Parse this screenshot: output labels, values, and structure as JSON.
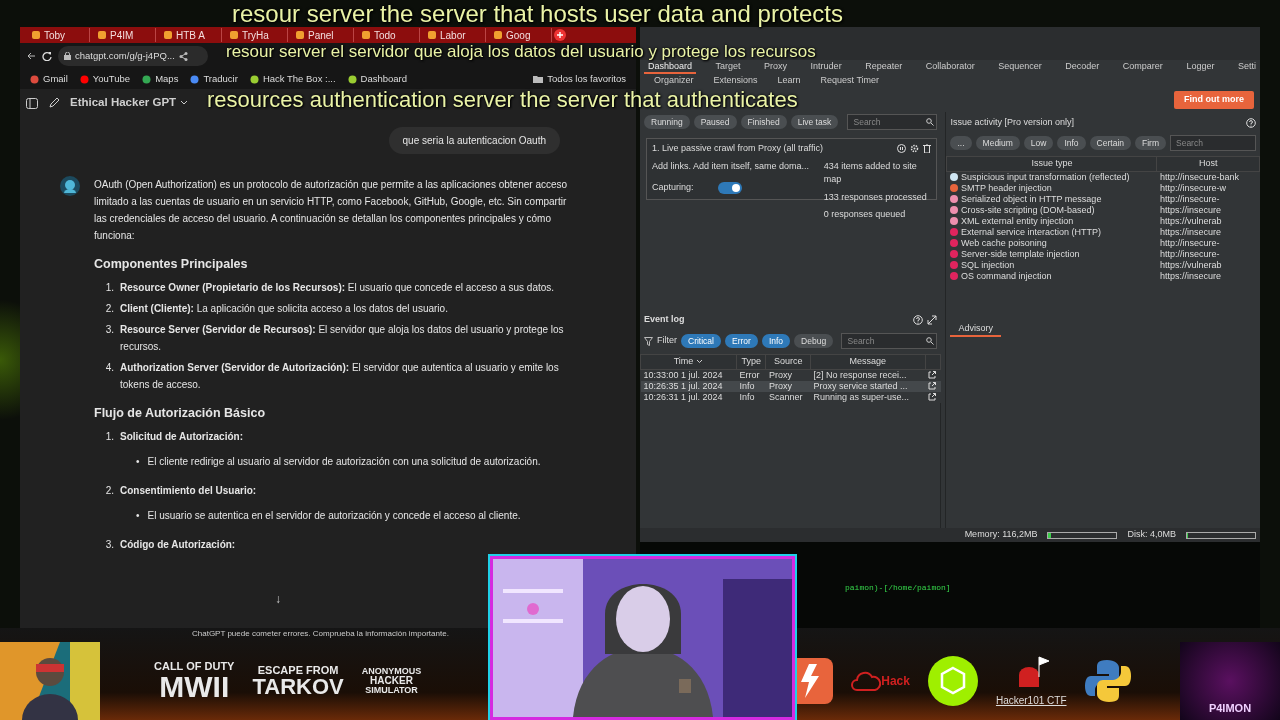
{
  "subtitles": [
    "resour server the server that hosts user data and protects",
    "resour server el servidor que aloja los datos del usuario y protege los recursos",
    "resources authentication server the server that authenticates"
  ],
  "browser": {
    "tabs": [
      {
        "label": "Toby",
        "selected": false
      },
      {
        "label": "P4IM",
        "selected": false
      },
      {
        "label": "HTB A",
        "selected": false
      },
      {
        "label": "TryHa",
        "selected": false
      },
      {
        "label": "Panel",
        "selected": false
      },
      {
        "label": "Todo",
        "selected": false
      },
      {
        "label": "Labor",
        "selected": false
      },
      {
        "label": "Goog",
        "selected": false
      }
    ],
    "url": "chatgpt.com/g/g-j4PQ...",
    "bookmarks": [
      "Gmail",
      "YouTube",
      "Maps",
      "Traducir",
      "Hack The Box :...",
      "Dashboard"
    ],
    "all_bookmarks": "Todos los favoritos"
  },
  "chat": {
    "title": "Ethical Hacker GPT",
    "user_message": "que seria la autenticacion Oauth",
    "intro": "OAuth (Open Authorization) es un protocolo de autorización que permite a las aplicaciones obtener acceso limitado a las cuentas de usuario en un servicio HTTP, como Facebook, GitHub, Google, etc. Sin compartir las credenciales de acceso del usuario. A continuación se detallan los componentes principales y cómo funciona:",
    "sections": [
      {
        "heading": "Componentes Principales",
        "items": [
          {
            "kind": "definition",
            "number": "1.",
            "text": "**Resource Owner (Propietario de los Recursos):** El usuario que concede el acceso a sus datos."
          },
          {
            "kind": "definition",
            "number": "2.",
            "text": "**Client (Cliente):** La aplicación que solicita acceso a los datos del usuario."
          },
          {
            "kind": "definition",
            "number": "3.",
            "text": "**Resource Server (Servidor de Recursos):** El servidor que aloja los datos del usuario y protege los recursos."
          },
          {
            "kind": "definition",
            "number": "4.",
            "text": "**Authorization Server (Servidor de Autorización):** El servidor que autentica al usuario y emite los tokens de acceso."
          }
        ]
      },
      {
        "heading": "Flujo de Autorización Básico",
        "items": [
          {
            "kind": "step",
            "number": "1.",
            "text": "Solicitud de Autorización:",
            "children": [
              {
                "marker": "•",
                "text": "El cliente redirige al usuario al servidor de autorización con una solicitud de autorización."
              }
            ]
          },
          {
            "kind": "step",
            "number": "2.",
            "text": "Consentimiento del Usuario:",
            "children": [
              {
                "marker": "•",
                "text": "El usuario se autentica en el servidor de autorización y concede el acceso al cliente."
              }
            ]
          },
          {
            "kind": "step",
            "number": "3.",
            "text": "Código de Autorización:"
          }
        ]
      }
    ],
    "scroll_arrow": "↓",
    "disclaimer": "ChatGPT puede cometer errores. Comprueba la información importante."
  },
  "burp": {
    "tabs": [
      {
        "label": "Dashboard",
        "selected": true
      },
      {
        "label": "Target",
        "selected": false
      },
      {
        "label": "Proxy",
        "selected": false
      },
      {
        "label": "Intruder",
        "selected": false
      },
      {
        "label": "Repeater",
        "selected": false
      },
      {
        "label": "Collaborator",
        "selected": false
      },
      {
        "label": "Sequencer",
        "selected": false
      },
      {
        "label": "Decoder",
        "selected": false
      },
      {
        "label": "Comparer",
        "selected": false
      },
      {
        "label": "Logger",
        "selected": false
      },
      {
        "label": "Setti",
        "selected": false
      }
    ],
    "subtabs": [
      "Organizer",
      "Extensions",
      "Learn",
      "Request Timer"
    ],
    "promo_button": "Find out more",
    "task_filters": [
      "Running",
      "Paused",
      "Finished"
    ],
    "live_task_button": "Live task",
    "task_search": {
      "placeholder": "Search"
    },
    "task": {
      "title": "1. Live passive crawl from Proxy (all traffic)",
      "description": "Add links. Add item itself, same doma...",
      "stats": [
        "434 items added to site map",
        "133 responses processed",
        "0 responses queued"
      ],
      "capturing_label": "Capturing:",
      "capturing": true
    },
    "issue_activity": {
      "title": "Issue activity [Pro version only]",
      "filters": [
        "...",
        "Medium",
        "Low",
        "Info",
        "Certain",
        "Firm"
      ],
      "search": {
        "placeholder": "Search"
      },
      "columns": [
        "Issue type",
        "Host"
      ],
      "rows": [
        {
          "issue": "Suspicious input transformation (reflected)",
          "host": "http://insecure-bank",
          "color": "#cfe6f2"
        },
        {
          "issue": "SMTP header injection",
          "host": "http://insecure-w",
          "color": "#e8643c"
        },
        {
          "issue": "Serialized object in HTTP message",
          "host": "http://insecure-",
          "color": "#ee8fae"
        },
        {
          "issue": "Cross-site scripting (DOM-based)",
          "host": "https://insecure",
          "color": "#ee8fae"
        },
        {
          "issue": "XML external entity injection",
          "host": "https://vulnerab",
          "color": "#ee8fae"
        },
        {
          "issue": "External service interaction (HTTP)",
          "host": "https://insecure",
          "color": "#e0245e"
        },
        {
          "issue": "Web cache poisoning",
          "host": "http://insecure-",
          "color": "#e0245e"
        },
        {
          "issue": "Server-side template injection",
          "host": "http://insecure-",
          "color": "#e0245e"
        },
        {
          "issue": "SQL injection",
          "host": "https://vulnerab",
          "color": "#e0245e"
        },
        {
          "issue": "OS command injection",
          "host": "https://insecure",
          "color": "#e0245e"
        }
      ]
    },
    "event_log": {
      "title": "Event log",
      "filter_label": "Filter",
      "filters": [
        {
          "label": "Critical",
          "selected": true
        },
        {
          "label": "Error",
          "selected": true
        },
        {
          "label": "Info",
          "selected": true
        },
        {
          "label": "Debug",
          "selected": false
        }
      ],
      "search": {
        "placeholder": "Search"
      },
      "columns": [
        "Time",
        "Type",
        "Source",
        "Message"
      ],
      "rows": [
        {
          "selected": false,
          "cells": [
            "10:33:00 1 jul. 2024",
            "Error",
            "Proxy",
            "[2]  No response recei..."
          ]
        },
        {
          "selected": true,
          "cells": [
            "10:26:35 1 jul. 2024",
            "Info",
            "Proxy",
            "Proxy service started ..."
          ]
        },
        {
          "selected": false,
          "cells": [
            "10:26:31 1 jul. 2024",
            "Info",
            "Scanner",
            "Running as super-use..."
          ]
        }
      ]
    },
    "advisory_tab": "Advisory",
    "memory": {
      "label": "Memory: 116,2MB",
      "level": 0.04
    },
    "disk": {
      "label": "Disk: 4,0MB",
      "level": 0.01
    }
  },
  "terminal": {
    "prompt": "paimon)-[/home/paimon]"
  },
  "stream": {
    "logos": [
      {
        "kind": "game",
        "lines": [
          "CALL OF DUTY",
          "MWII"
        ]
      },
      {
        "kind": "game",
        "lines": [
          "ESCAPE FROM",
          "TARKOV"
        ]
      },
      {
        "kind": "game",
        "lines": [
          "ANONYMOUS",
          "HACKER",
          "SIMULATOR"
        ]
      }
    ],
    "tryhackme_label": "Hack",
    "hacker101_label": "Hacker101 CTF",
    "channel_label": "P4IMON"
  }
}
